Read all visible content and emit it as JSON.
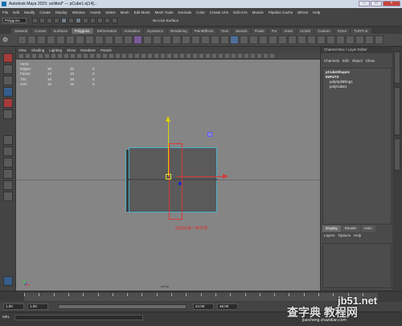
{
  "window": {
    "title": "Autodesk Maya 2015: untitled*   ---   pCube1.e[14]...",
    "buttons": [
      "–",
      "□",
      "×"
    ]
  },
  "menubar": [
    "File",
    "Edit",
    "Modify",
    "Create",
    "Display",
    "Window",
    "Assets",
    "Select",
    "Mesh",
    "Edit Mesh",
    "Mesh Tools",
    "Normals",
    "Color",
    "Create UVs",
    "Edit UVs",
    "Muscle",
    "Pipeline Cache",
    "Bifrost",
    "Help"
  ],
  "statusline": {
    "mode": "Polygons",
    "surface_label": "No Live Surface"
  },
  "shelf_tabs": {
    "items": [
      "General",
      "Curves",
      "Surfaces",
      "Polygons",
      "Deformation",
      "Animation",
      "Dynamics",
      "Rendering",
      "PaintEffects",
      "Toon",
      "Muscle",
      "Fluids",
      "Fur",
      "nHair",
      "nCloth",
      "Custom",
      "XGen",
      "TURTLE"
    ],
    "active": "Polygons"
  },
  "viewport": {
    "menu": [
      "View",
      "Shading",
      "Lighting",
      "Show",
      "Renderer",
      "Panels"
    ],
    "hud": [
      {
        "label": "Verts:",
        "v1": "",
        "v2": "",
        "v3": ""
      },
      {
        "label": "Edges:",
        "v1": "20",
        "v2": "20",
        "v3": "0"
      },
      {
        "label": "Faces:",
        "v1": "10",
        "v2": "10",
        "v3": "0"
      },
      {
        "label": "Tris:",
        "v1": "16",
        "v2": "16",
        "v3": "0"
      },
      {
        "label": "UVs:",
        "v1": "16",
        "v2": "16",
        "v3": "0"
      }
    ],
    "annotation": "切割出来一条中线",
    "camera": "persp"
  },
  "channel_box": {
    "title": "Channel Box / Layer Editor",
    "menu": [
      "Channels",
      "Edit",
      "Object",
      "Show"
    ],
    "lines": [
      {
        "text": "pCubeShape1",
        "indent": false
      },
      {
        "text": "INPUTS",
        "indent": false
      },
      {
        "text": "polySplitRing1",
        "indent": true
      },
      {
        "text": "polyCube1",
        "indent": true
      }
    ]
  },
  "layer_editor": {
    "tabs": [
      "Display",
      "Render",
      "Anim"
    ],
    "active": "Display",
    "menu": [
      "Layers",
      "Options",
      "Help"
    ]
  },
  "range": {
    "start": "1.00",
    "start2": "1.00",
    "slider_start": "1",
    "slider_end": "24",
    "end": "24.00",
    "end2": "48.00"
  },
  "cmdline": {
    "label": "MEL"
  },
  "watermark": {
    "line1": "jb51.net",
    "line2": "查字典 教程网",
    "line3": "jiaocheng.chazidian.com"
  }
}
